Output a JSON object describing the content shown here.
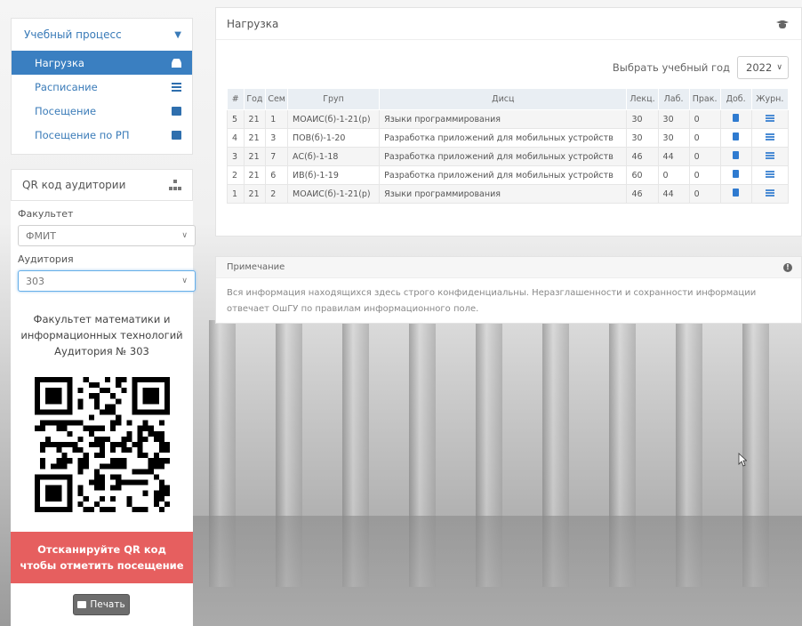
{
  "colors": {
    "accent": "#3a7fc1",
    "danger": "#e65f5f",
    "button": "#6d6d6d"
  },
  "menu": {
    "title": "Учебный процесс",
    "items": [
      {
        "label": "Нагрузка",
        "icon": "user-icon",
        "active": true
      },
      {
        "label": "Расписание",
        "icon": "list-icon",
        "active": false
      },
      {
        "label": "Посещение",
        "icon": "calendar-icon",
        "active": false
      },
      {
        "label": "Посещение по РП",
        "icon": "calendar-icon",
        "active": false
      }
    ]
  },
  "qr_panel": {
    "title": "QR код аудитории",
    "faculty_label": "Факультет",
    "faculty_value": "ФМИТ",
    "room_label": "Аудитория",
    "room_value": "303",
    "caption_line1": "Факультет математики и",
    "caption_line2": "информационных технологий",
    "caption_line3": "Аудитория № 303",
    "scan_text": "Отсканируйте QR код чтобы отметить посещение",
    "print_label": "Печать"
  },
  "load": {
    "title": "Нагрузка",
    "year_label": "Выбрать учебный год",
    "year_value": "2022",
    "columns": [
      "#",
      "Год",
      "Сем",
      "Груп",
      "Дисц",
      "Лекц.",
      "Лаб.",
      "Прак.",
      "Доб.",
      "Журн."
    ],
    "rows": [
      {
        "n": "5",
        "year": "21",
        "sem": "1",
        "group": "МОАИС(б)-1-21(р)",
        "disc": "Языки программирования",
        "lec": "30",
        "lab": "30",
        "prac": "0"
      },
      {
        "n": "4",
        "year": "21",
        "sem": "3",
        "group": "ПОВ(б)-1-20",
        "disc": "Разработка приложений для мобильных устройств",
        "lec": "30",
        "lab": "30",
        "prac": "0"
      },
      {
        "n": "3",
        "year": "21",
        "sem": "7",
        "group": "АС(б)-1-18",
        "disc": "Разработка приложений для мобильных устройств",
        "lec": "46",
        "lab": "44",
        "prac": "0"
      },
      {
        "n": "2",
        "year": "21",
        "sem": "6",
        "group": "ИВ(б)-1-19",
        "disc": "Разработка приложений для мобильных устройств",
        "lec": "60",
        "lab": "0",
        "prac": "0"
      },
      {
        "n": "1",
        "year": "21",
        "sem": "2",
        "group": "МОАИС(б)-1-21(р)",
        "disc": "Языки программирования",
        "lec": "46",
        "lab": "44",
        "prac": "0"
      }
    ]
  },
  "note": {
    "title": "Примечание",
    "text_line1": "Вся информация находящихся здесь строго конфиденциальны. Неразглашенности и сохранности информации",
    "text_line2": "отвечает ОшГУ по правилам информационного поле."
  }
}
